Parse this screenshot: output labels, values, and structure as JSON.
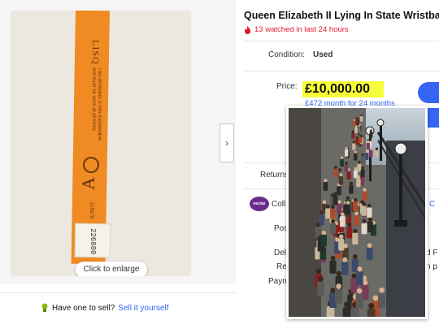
{
  "gallery": {
    "photo": {
      "band_lisq": "LISQ",
      "band_letter": "A",
      "band_serial_small": "015979",
      "band_serial": "226880",
      "band_text": "This wristband is non-transferable and must be worn at all times"
    },
    "enlarge_label": "Click to enlarge",
    "next_icon": "chevron-right-icon",
    "sell_prompt": "Have one to sell?",
    "sell_link": "Sell it yourself"
  },
  "listing": {
    "title": "Queen Elizabeth II Lying In State Wristban",
    "watched": "13 watched in last 24 hours",
    "condition_label": "Condition:",
    "condition_value": "Used",
    "price_label": "Price:",
    "price_value": "£10,000.00",
    "monthly": "£472 month for 24 months",
    "returns_label": "Returns:",
    "nectar_label": "nectar",
    "collect_label": "Coll",
    "collect_link": "C",
    "postage_label": "Pos",
    "delivery_label": "Del",
    "returns2_label": "Re",
    "payments_label": "Paym",
    "right_delivery": "d F",
    "right_returns": "n p",
    "right_more": "s"
  },
  "colors": {
    "accent": "#3665f3",
    "watched": "#e0182d",
    "highlight": "#f7ff3a",
    "wristband": "#f08a22",
    "nectar": "#6c2c8c"
  }
}
